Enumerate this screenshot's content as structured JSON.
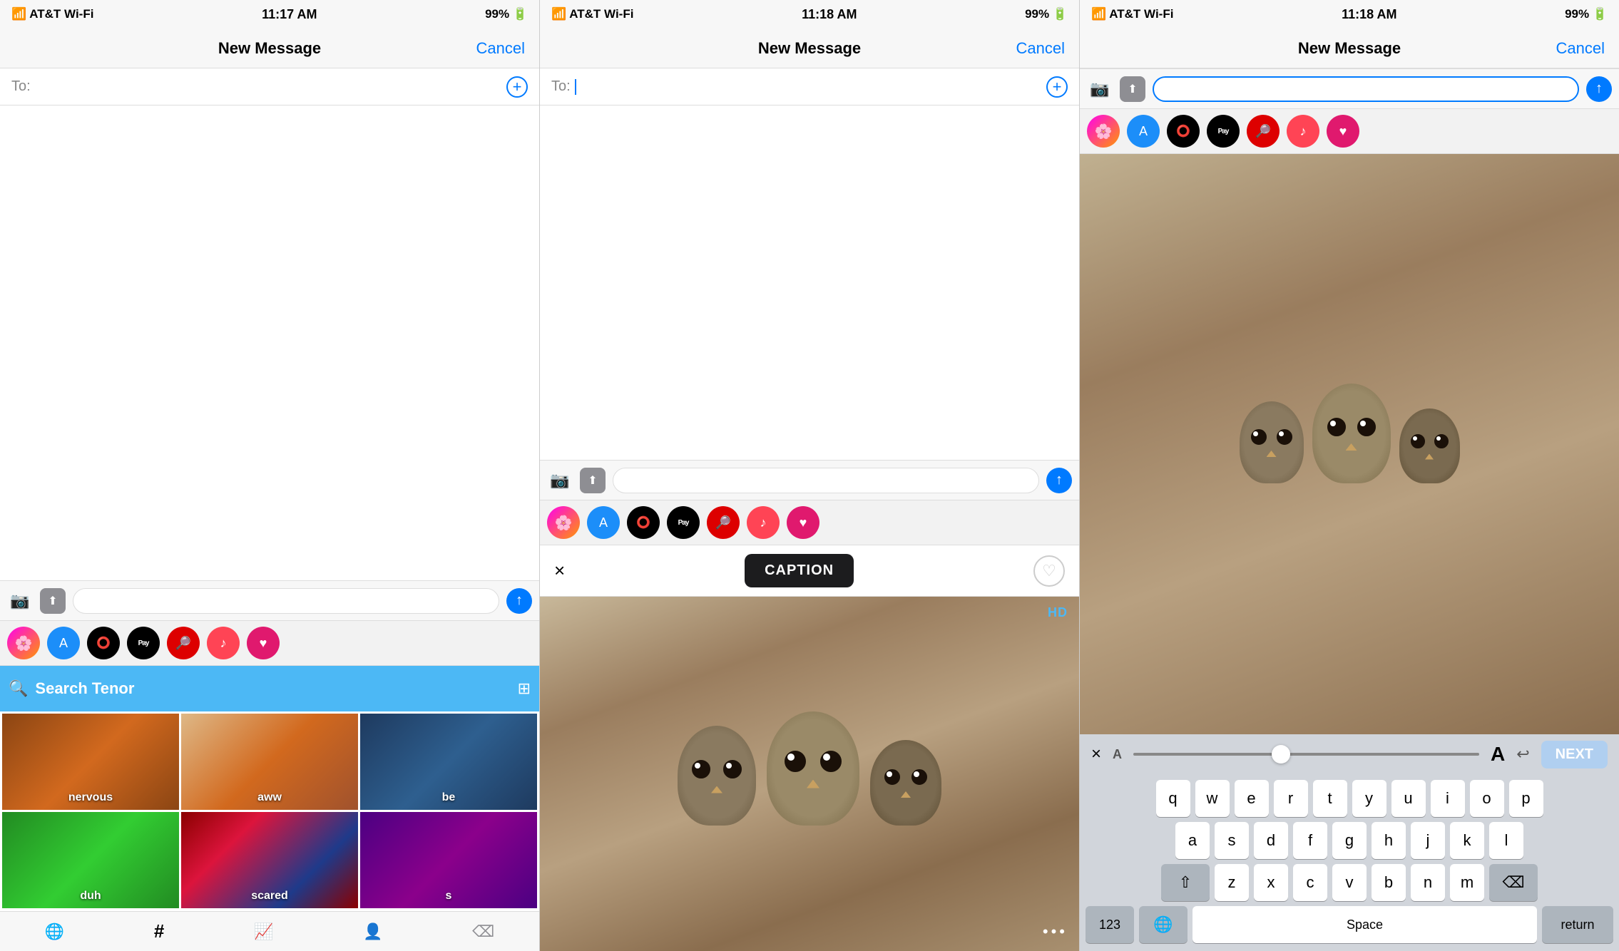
{
  "panels": [
    {
      "id": "panel1",
      "status": {
        "carrier": "AT&T Wi-Fi",
        "time": "11:17 AM",
        "battery": "99%"
      },
      "nav": {
        "title": "New Message",
        "cancel": "Cancel"
      },
      "to_label": "To:",
      "apps": [
        "photos",
        "appstore",
        "fitness",
        "applepay",
        "search",
        "music",
        "heart"
      ],
      "tenor": {
        "search_placeholder": "Search Tenor"
      },
      "gifs": [
        {
          "label": "nervous",
          "col": 0
        },
        {
          "label": "aww",
          "col": 1
        },
        {
          "label": "be",
          "col": 2
        },
        {
          "label": "duh",
          "col": 0
        },
        {
          "label": "scared",
          "col": 1
        },
        {
          "label": "s",
          "col": 2
        }
      ],
      "bottom_tabs": [
        "globe",
        "hashtag",
        "trending",
        "person",
        "delete"
      ]
    },
    {
      "id": "panel2",
      "status": {
        "carrier": "AT&T Wi-Fi",
        "time": "11:18 AM",
        "battery": "99%"
      },
      "nav": {
        "title": "New Message",
        "cancel": "Cancel"
      },
      "to_label": "To:",
      "caption_bar": {
        "close": "×",
        "caption": "CAPTION",
        "heart": "♡"
      },
      "hd_badge": "HD",
      "more": "•••"
    },
    {
      "id": "panel3",
      "status": {
        "carrier": "AT&T Wi-Fi",
        "time": "11:18 AM",
        "battery": "99%"
      },
      "nav": {
        "title": "New Message",
        "cancel": "Cancel"
      },
      "apps": [
        "photos",
        "appstore",
        "fitness",
        "applepay",
        "search",
        "music",
        "heart"
      ],
      "text_tools": {
        "close": "×",
        "a_small": "A",
        "a_large": "A",
        "undo": "↩",
        "next": "NEXT"
      },
      "keyboard": {
        "row1": [
          "q",
          "w",
          "e",
          "r",
          "t",
          "y",
          "u",
          "i",
          "o",
          "p"
        ],
        "row2": [
          "a",
          "s",
          "d",
          "f",
          "g",
          "h",
          "j",
          "k",
          "l"
        ],
        "row3": [
          "z",
          "x",
          "c",
          "v",
          "b",
          "n",
          "m"
        ],
        "bottom": {
          "num": "123",
          "globe": "🌐",
          "space": "Space",
          "return": "return"
        }
      }
    }
  ]
}
